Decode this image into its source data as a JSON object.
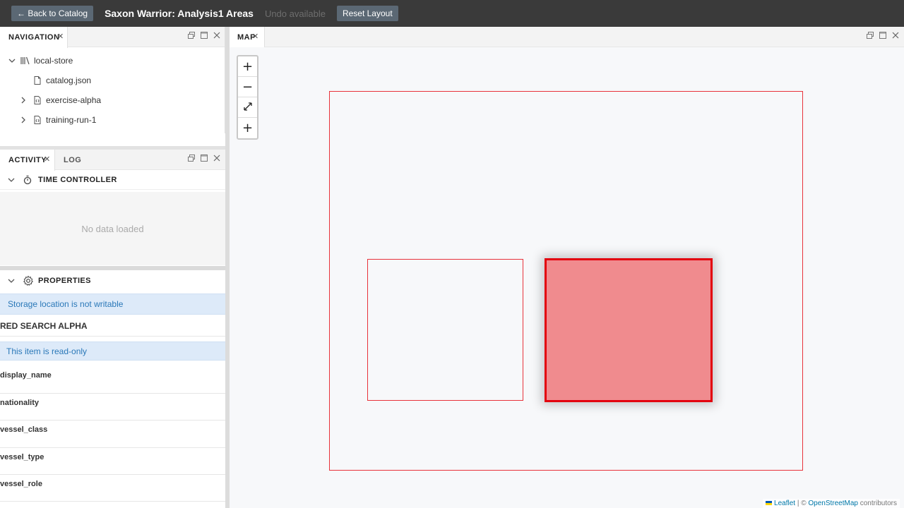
{
  "topbar": {
    "back_label": "← Back to Catalog",
    "title": "Saxon Warrior: Analysis1 Areas",
    "undo_label": "Undo available",
    "reset_label": "Reset Layout"
  },
  "navigation": {
    "tab_label": "NAVIGATION",
    "tree": [
      {
        "label": "local-store",
        "expanded": true,
        "icon": "library-icon"
      },
      {
        "label": "catalog.json",
        "icon": "file-icon"
      },
      {
        "label": "exercise-alpha",
        "expanded": false,
        "icon": "json-file-icon"
      },
      {
        "label": "training-run-1",
        "expanded": false,
        "icon": "json-file-icon"
      }
    ]
  },
  "activity": {
    "tabs": [
      "ACTIVITY",
      "LOG"
    ],
    "time_controller": {
      "title": "TIME CONTROLLER",
      "empty_text": "No data loaded"
    },
    "properties": {
      "title": "PROPERTIES",
      "storage_notice": "Storage location is not writable",
      "item_title": "RED SEARCH ALPHA",
      "readonly_notice": "This item is read-only",
      "fields": [
        "display_name",
        "nationality",
        "vessel_class",
        "vessel_type",
        "vessel_role"
      ]
    }
  },
  "map": {
    "tab_label": "MAP",
    "zoom_in": "+",
    "zoom_out": "−",
    "fit_icon": "fullscreen-icon",
    "add": "+",
    "attribution": {
      "leaflet": "Leaflet",
      "sep": " | © ",
      "osm": "OpenStreetMap",
      "contributors": " contributors"
    }
  },
  "colors": {
    "topbar_bg": "#3a3a3a",
    "area_stroke": "#e8323a",
    "selected_fill": "#f08b8e",
    "selected_stroke": "#e3000f",
    "info_blue": "#2a78b8"
  }
}
